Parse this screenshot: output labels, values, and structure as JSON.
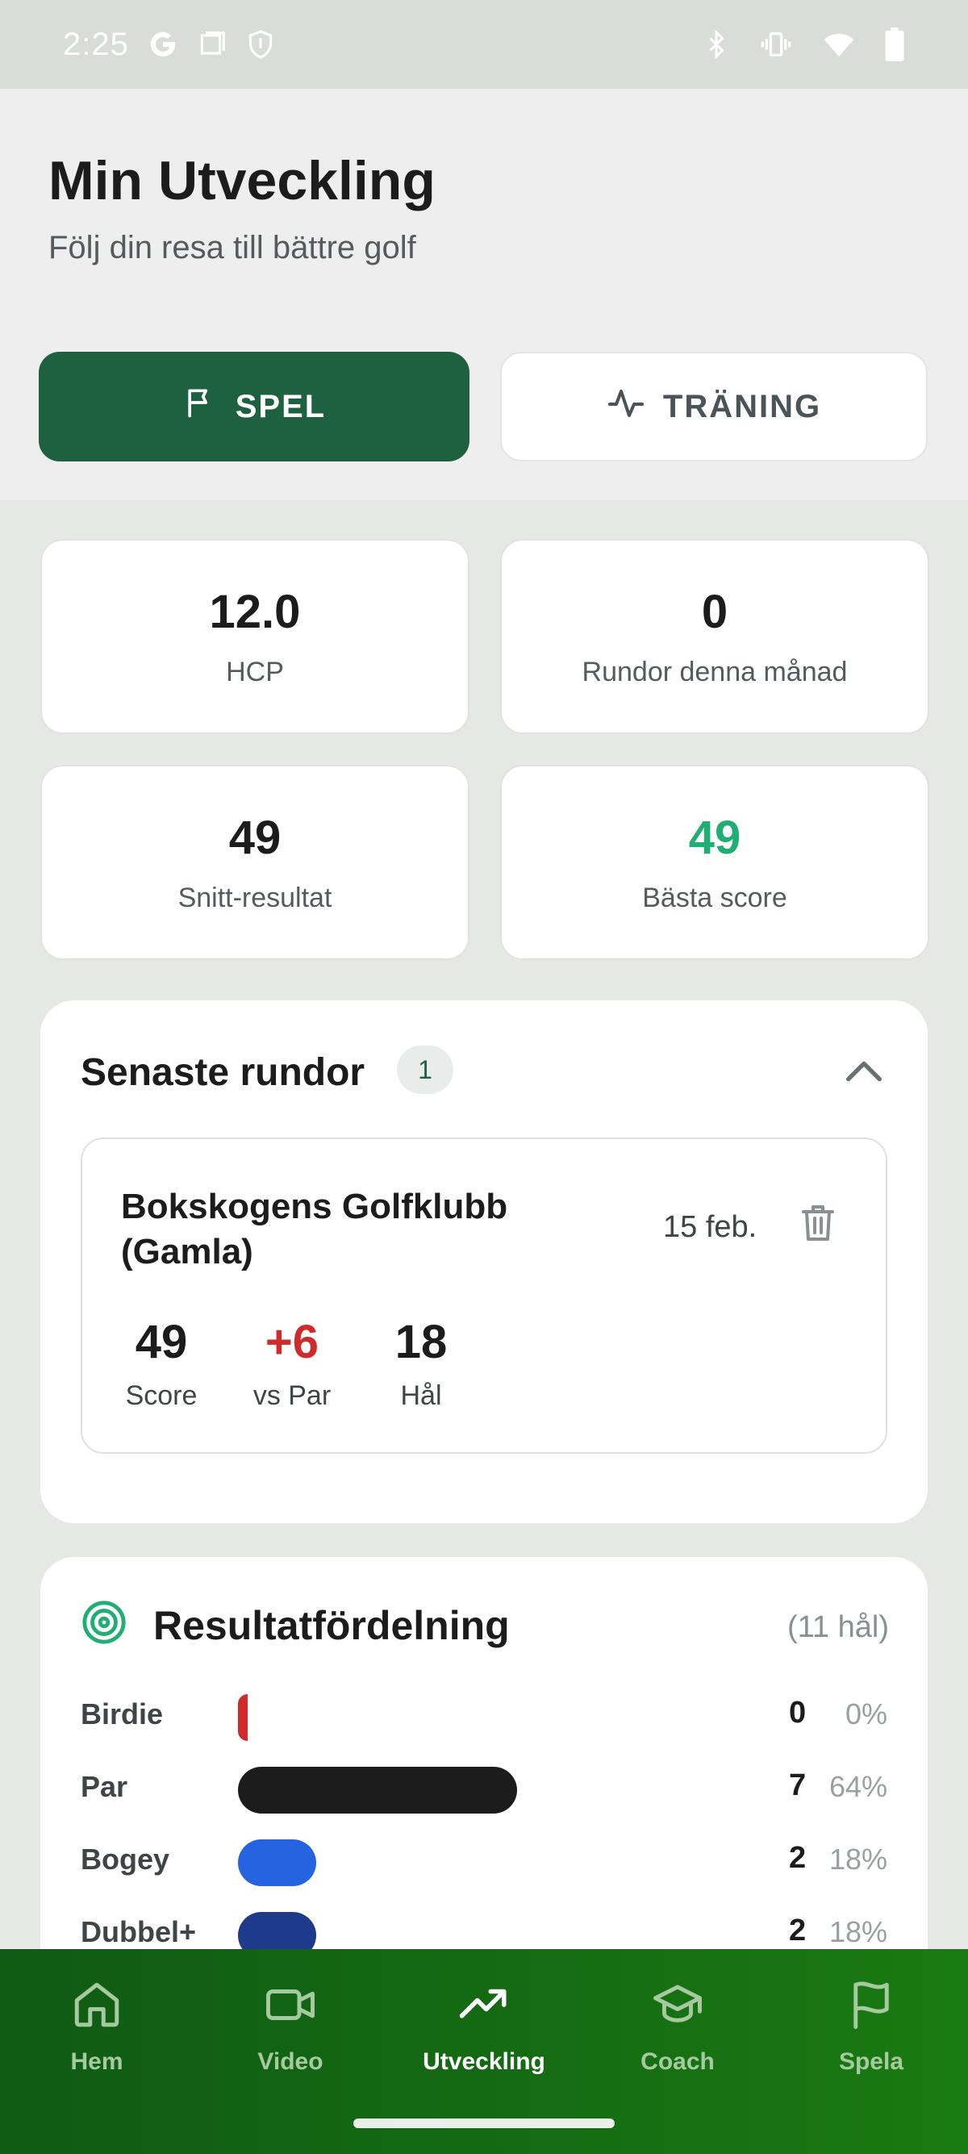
{
  "status_bar": {
    "time": "2:25",
    "icons_left": [
      "google-icon",
      "screenshot-icon",
      "shield-icon"
    ],
    "icons_right": [
      "bluetooth-icon",
      "vibrate-icon",
      "wifi-icon",
      "battery-icon"
    ]
  },
  "header": {
    "title": "Min Utveckling",
    "subtitle": "Följ din resa till bättre golf"
  },
  "mode_tabs": [
    {
      "label": "SPEL",
      "icon": "flag-icon",
      "active": true
    },
    {
      "label": "TRÄNING",
      "icon": "activity-icon",
      "active": false
    }
  ],
  "stats": [
    {
      "value": "12.0",
      "label": "HCP"
    },
    {
      "value": "0",
      "label": "Rundor denna månad"
    },
    {
      "value": "49",
      "label": "Snitt-resultat"
    },
    {
      "value": "49",
      "label": "Bästa score",
      "color": "#1fae74"
    }
  ],
  "recent_rounds": {
    "title": "Senaste rundor",
    "count": "1",
    "rounds": [
      {
        "course": "Bokskogens Golfklubb (Gamla)",
        "date": "15 feb.",
        "stats": [
          {
            "value": "49",
            "label": "Score"
          },
          {
            "value": "+6",
            "label": "vs Par",
            "color": "#d12a2a"
          },
          {
            "value": "18",
            "label": "Hål"
          }
        ]
      }
    ]
  },
  "distribution": {
    "title": "Resultatfördelning",
    "holes": "(11 hål)",
    "rows": [
      {
        "label": "Birdie",
        "count": "0",
        "pct": "0%",
        "fraction": 0.0,
        "color": "#d12a2a"
      },
      {
        "label": "Par",
        "count": "7",
        "pct": "64%",
        "fraction": 0.64,
        "color": "#1c1c1c"
      },
      {
        "label": "Bogey",
        "count": "2",
        "pct": "18%",
        "fraction": 0.18,
        "color": "#2563e0"
      },
      {
        "label": "Dubbel+",
        "count": "2",
        "pct": "18%",
        "fraction": 0.18,
        "color": "#1e3a8a"
      }
    ]
  },
  "bottom_nav": [
    {
      "label": "Hem",
      "icon": "home-icon",
      "active": false
    },
    {
      "label": "Video",
      "icon": "video-icon",
      "active": false
    },
    {
      "label": "Utveckling",
      "icon": "trending-up-icon",
      "active": true
    },
    {
      "label": "Coach",
      "icon": "graduation-cap-icon",
      "active": false
    },
    {
      "label": "Spela",
      "icon": "flag-icon",
      "active": false
    }
  ],
  "colors": {
    "primary": "#1e6140",
    "accent_green": "#1fae74",
    "over_par_red": "#d12a2a",
    "nav_bg": "#1a7a12"
  }
}
